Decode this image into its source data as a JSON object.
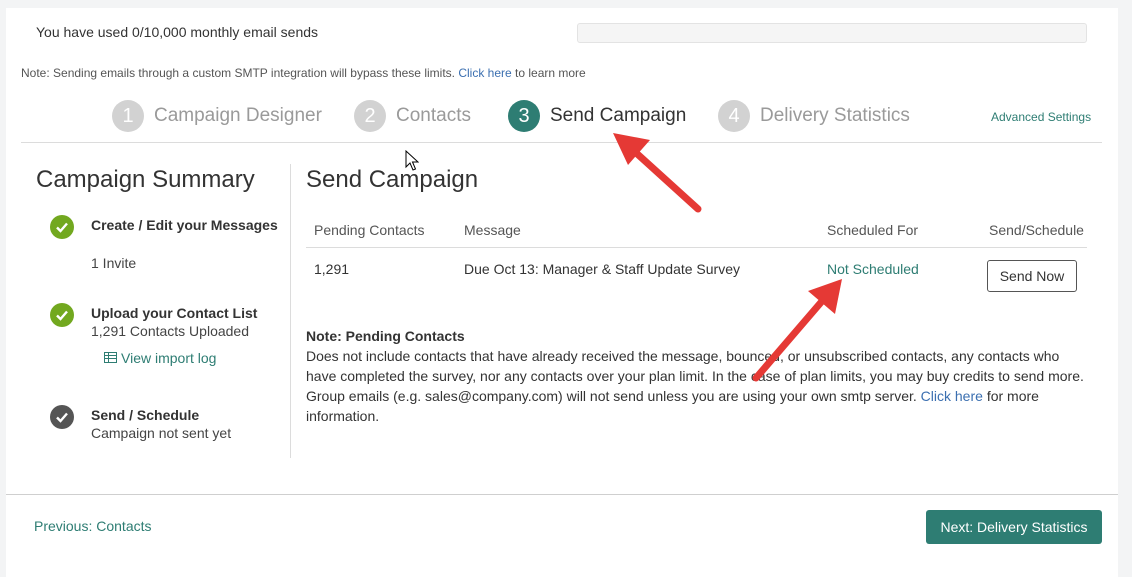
{
  "usage": {
    "text": "You have used 0/10,000 monthly email sends",
    "progress": 0
  },
  "smtp_note": {
    "text": "Note: Sending emails through a custom SMTP integration will bypass these limits.",
    "link": "Click here",
    "suffix": "to learn more"
  },
  "steps": [
    {
      "num": "1",
      "label": "Campaign Designer",
      "active": false
    },
    {
      "num": "2",
      "label": "Contacts",
      "active": false
    },
    {
      "num": "3",
      "label": "Send Campaign",
      "active": true
    },
    {
      "num": "4",
      "label": "Delivery Statistics",
      "active": false
    }
  ],
  "advanced_settings": "Advanced Settings",
  "summary": {
    "title": "Campaign Summary",
    "items": [
      {
        "title": "Create / Edit your Messages",
        "sub": "1 Invite",
        "status": "done"
      },
      {
        "title": "Upload your Contact List",
        "sub": "1,291 Contacts Uploaded",
        "link": "View import log",
        "status": "done"
      },
      {
        "title": "Send / Schedule",
        "sub": "Campaign not sent yet",
        "status": "pending"
      }
    ]
  },
  "send": {
    "title": "Send Campaign",
    "columns": [
      "Pending Contacts",
      "Message",
      "Scheduled For",
      "Send/Schedule"
    ],
    "row": {
      "pending": "1,291",
      "message": "Due Oct 13: Manager & Staff Update Survey",
      "scheduled": "Not Scheduled",
      "action": "Send Now"
    },
    "note_title": "Note: Pending Contacts",
    "note_text": "Does not include contacts that have already received the message, bounced, or unsubscribed contacts, any contacts who have completed the survey, nor any contacts over your plan limit. In the case of plan limits, you may buy credits to send more. Group emails (e.g. sales@company.com) will not send unless you are using your own smtp server.",
    "note_link": "Click here",
    "note_suffix": "for more information."
  },
  "footer": {
    "previous": "Previous: Contacts",
    "next": "Next: Delivery Statistics"
  },
  "colors": {
    "accent": "#2e7d73",
    "check_done": "#72a81f",
    "check_pending": "#555555",
    "arrow": "#e53935"
  }
}
